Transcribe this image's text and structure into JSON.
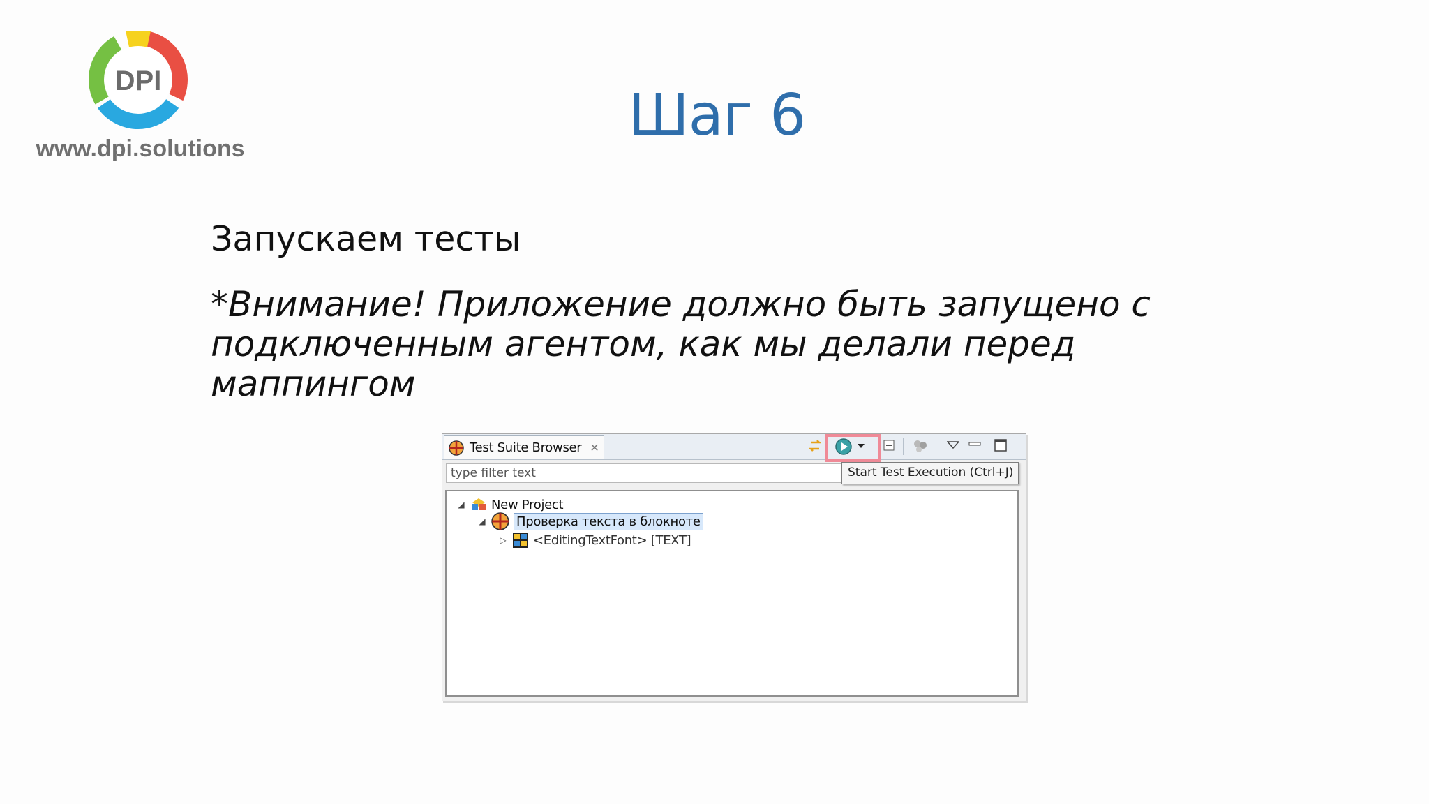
{
  "logo": {
    "mark": "DPI",
    "url": "www.dpi.solutions"
  },
  "slide": {
    "title": "Шаг 6",
    "subtitle": "Запускаем тесты",
    "attention_lines": [
      "*Внимание! Приложение должно быть запущено с",
      "подключенным агентом, как мы делали перед",
      "маппингом"
    ]
  },
  "screenshot": {
    "tab": {
      "label": "Test Suite Browser",
      "icon": "test-suite-icon",
      "close_icon": "close-icon"
    },
    "toolbar": {
      "icons": [
        "link-editor-icon",
        "start-test-execution-icon",
        "dropdown-arrow-icon",
        "collapse-all-icon",
        "filter-icon",
        "view-menu-icon",
        "minimize-icon",
        "maximize-icon"
      ],
      "highlight_color": "#ef8a97"
    },
    "filter_placeholder": "type filter text",
    "tooltip": "Start Test Execution (Ctrl+J)",
    "tree": [
      {
        "label": "New Project",
        "icon": "project-icon",
        "expanded": true
      },
      {
        "label": "Проверка текста в блокноте",
        "icon": "test-suite-icon",
        "expanded": true,
        "selected": true
      },
      {
        "label": "<EditingTextFont> [TEXT]",
        "icon": "test-case-icon",
        "expanded": false
      }
    ]
  },
  "colors": {
    "title": "#2f6eab",
    "selection": "#d7e8fb"
  }
}
